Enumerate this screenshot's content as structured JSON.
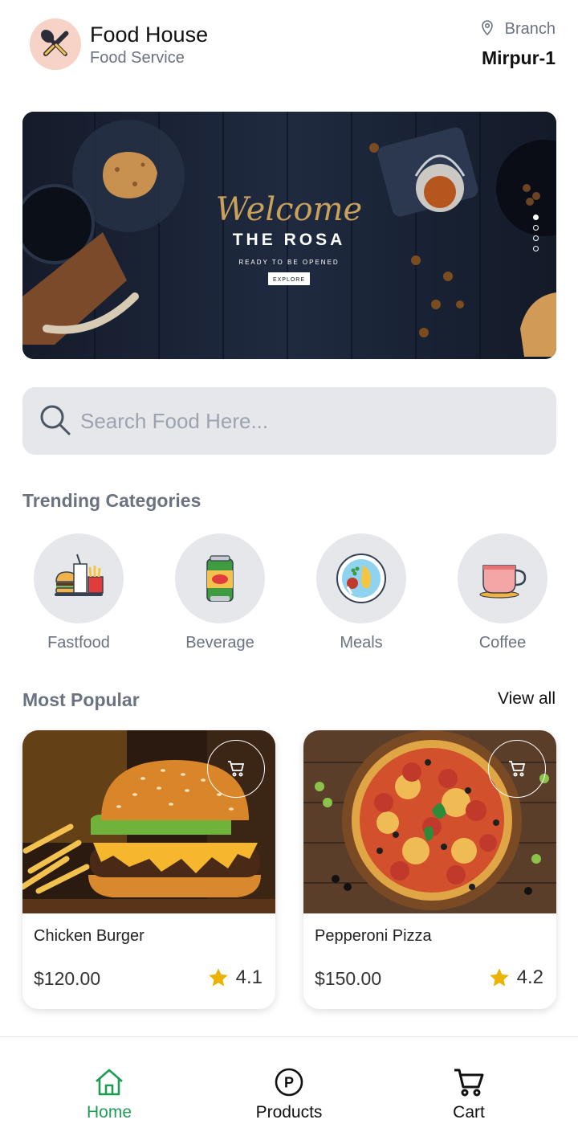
{
  "header": {
    "title": "Food House",
    "subtitle": "Food Service",
    "branch_label": "Branch",
    "branch_value": "Mirpur-1"
  },
  "banner": {
    "welcome": "Welcome",
    "title": "THE ROSA",
    "tagline": "READY TO BE OPENED",
    "button_label": "EXPLORE",
    "slide_count": 4,
    "active_slide": 1
  },
  "search": {
    "placeholder": "Search Food Here..."
  },
  "categories": {
    "title": "Trending Categories",
    "items": [
      {
        "label": "Fastfood",
        "icon": "fastfood-icon"
      },
      {
        "label": "Beverage",
        "icon": "beverage-can-icon"
      },
      {
        "label": "Meals",
        "icon": "meal-plate-icon"
      },
      {
        "label": "Coffee",
        "icon": "coffee-cup-icon"
      }
    ]
  },
  "popular": {
    "title": "Most Popular",
    "view_all": "View all",
    "items": [
      {
        "name": "Chicken Burger",
        "price": "$120.00",
        "rating": "4.1",
        "image": "burger-photo"
      },
      {
        "name": "Pepperoni Pizza",
        "price": "$150.00",
        "rating": "4.2",
        "image": "pizza-photo"
      }
    ]
  },
  "nav": {
    "items": [
      {
        "label": "Home",
        "icon": "home-icon",
        "active": true
      },
      {
        "label": "Products",
        "icon": "products-icon",
        "active": false
      },
      {
        "label": "Cart",
        "icon": "cart-icon",
        "active": false
      }
    ]
  },
  "colors": {
    "accent": "#1f9d55",
    "muted_text": "#6b7280",
    "surface": "#e5e7eb",
    "star": "#eab308"
  }
}
